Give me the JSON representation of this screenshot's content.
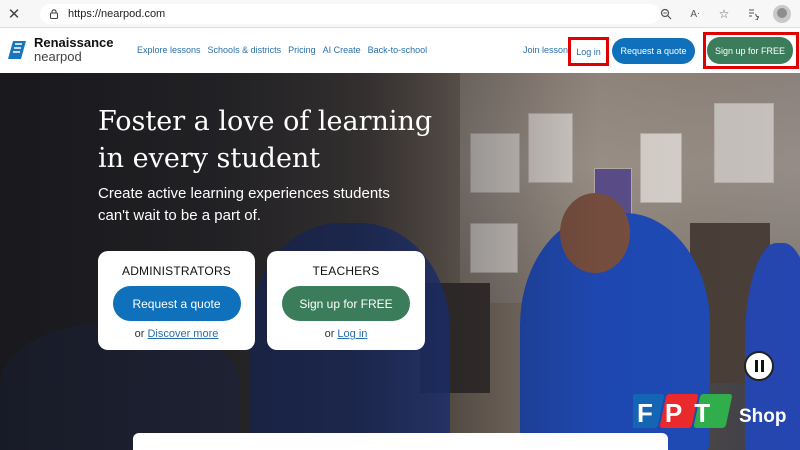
{
  "browser": {
    "url": "https://nearpod.com",
    "icons": [
      "close-icon",
      "lock-icon",
      "zoom-icon",
      "read-aloud-icon",
      "favorite-icon",
      "collections-icon",
      "profile-icon"
    ]
  },
  "header": {
    "brand": "Renaissance",
    "product": "nearpod",
    "nav": [
      "Explore lessons",
      "Schools & districts",
      "Pricing",
      "AI Create",
      "Back-to-school"
    ],
    "join_lesson": "Join lesson",
    "login": "Log in",
    "request_quote": "Request a quote",
    "signup": "Sign up for FREE"
  },
  "hero": {
    "headline": "Foster a love of learning in every student",
    "subhead": "Create active learning experiences students can't wait to be a part of.",
    "admin_card": {
      "title": "ADMINISTRATORS",
      "button": "Request a quote",
      "or": "or",
      "link": "Discover more"
    },
    "teacher_card": {
      "title": "TEACHERS",
      "button": "Sign up for FREE",
      "or": "or",
      "link": "Log in"
    }
  },
  "watermark": {
    "letters": "FPT",
    "word": "Shop"
  },
  "colors": {
    "blue": "#0f70bb",
    "green": "#3b7d5a",
    "link": "#2a6fab",
    "highlight": "#e00000"
  }
}
